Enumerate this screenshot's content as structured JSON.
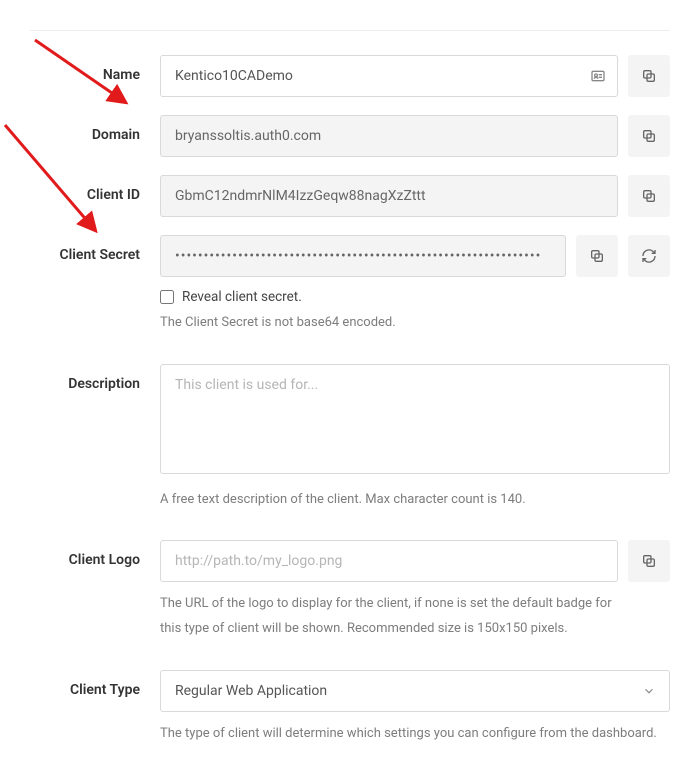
{
  "fields": {
    "name": {
      "label": "Name",
      "value": "Kentico10CADemo"
    },
    "domain": {
      "label": "Domain",
      "value": "bryanssoltis.auth0.com"
    },
    "client_id": {
      "label": "Client ID",
      "value": "GbmC12ndmrNlM4IzzGeqw88nagXzZttt"
    },
    "client_secret": {
      "label": "Client Secret",
      "masked": "••••••••••••••••••••••••••••••••••••••••••••••••••••••••••••••••",
      "reveal_label": "Reveal client secret.",
      "encoding_note": "The Client Secret is not base64 encoded."
    },
    "description": {
      "label": "Description",
      "placeholder": "This client is used for...",
      "helper": "A free text description of the client. Max character count is 140."
    },
    "client_logo": {
      "label": "Client Logo",
      "placeholder": "http://path.to/my_logo.png",
      "helper": "The URL of the logo to display for the client, if none is set the default badge for this type of client will be shown. Recommended size is 150x150 pixels."
    },
    "client_type": {
      "label": "Client Type",
      "value": "Regular Web Application",
      "helper": "The type of client will determine which settings you can configure from the dashboard."
    }
  }
}
